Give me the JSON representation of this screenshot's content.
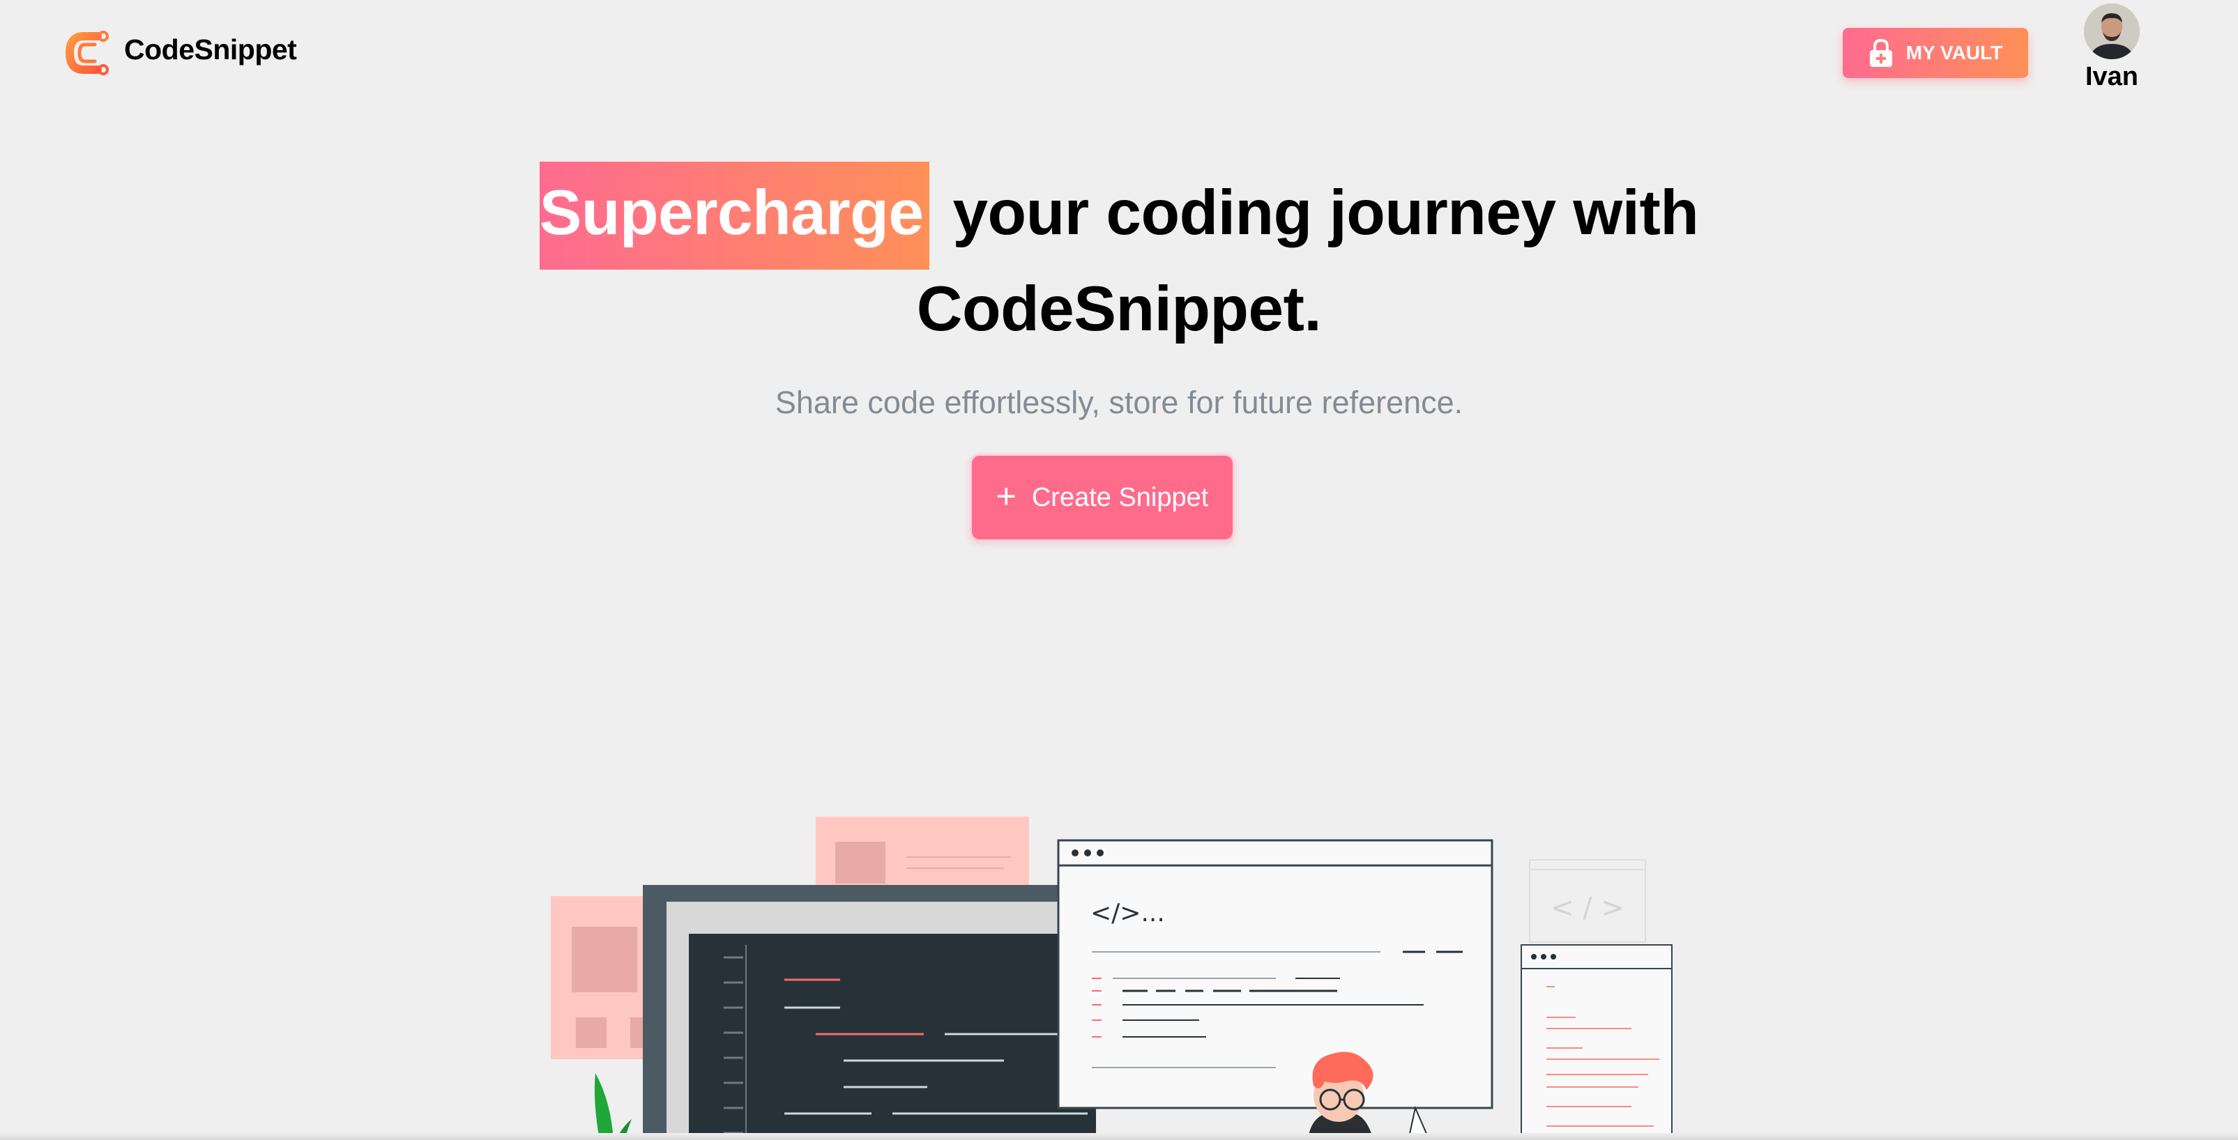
{
  "header": {
    "brand": "CodeSnippet",
    "logo_icon": "codesnippet-logo-icon",
    "vault_label": "MY VAULT",
    "vault_icon": "lock-plus-icon",
    "user_name": "Ivan"
  },
  "hero": {
    "headline_lead": "Supercharge",
    "headline_rest": "your coding journey with",
    "headline_line2": "CodeSnippet.",
    "subtitle": "Share code effortlessly, store for future reference.",
    "cta_label": "Create Snippet",
    "cta_icon": "plus-icon",
    "illustration_text": "</>..."
  },
  "colors": {
    "accent_start": "#ff6b90",
    "accent_end": "#ff9058",
    "background": "#f0efef",
    "subtitle": "#838b93"
  }
}
